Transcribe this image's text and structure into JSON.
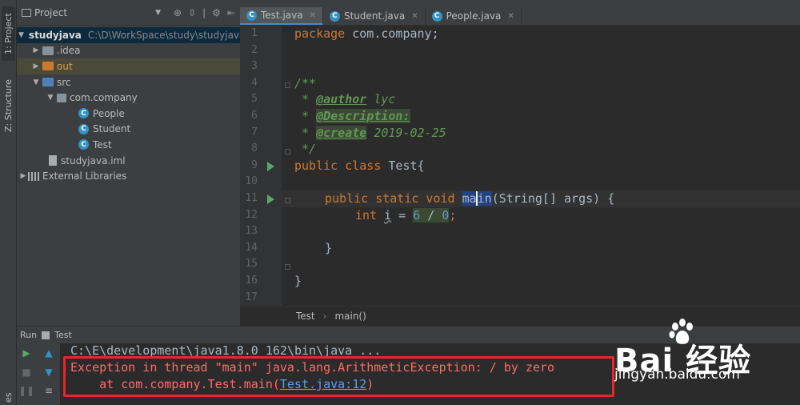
{
  "left_strip": {
    "project_tab": "1: Project",
    "structure_tab": "Z: Structure",
    "bottom_text": "es"
  },
  "project": {
    "title": "Project",
    "root": {
      "name": "studyjava",
      "path": "C:\\D\\WorkSpace\\study\\studyjava"
    },
    "items": [
      {
        "label": ".idea"
      },
      {
        "label": "out"
      },
      {
        "label": "src"
      },
      {
        "label": "com.company"
      },
      {
        "label": "People"
      },
      {
        "label": "Student"
      },
      {
        "label": "Test"
      },
      {
        "label": "studyjava.iml"
      },
      {
        "label": "External Libraries"
      }
    ]
  },
  "tabs": [
    {
      "label": "Test.java"
    },
    {
      "label": "Student.java"
    },
    {
      "label": "People.java"
    }
  ],
  "editor": {
    "line_numbers": [
      "1",
      "2",
      "3",
      "4",
      "5",
      "6",
      "7",
      "8",
      "9",
      "10",
      "11",
      "12",
      "13",
      "14",
      "15",
      "16",
      "17"
    ],
    "lines": {
      "l1_kw": "package",
      "l1_rest": " com.company;",
      "l4": "/**",
      "l5_star": " * ",
      "l5_tag": "@author",
      "l5_val": " lyc",
      "l6_star": " * ",
      "l6_tag": "@Description:",
      "l7_star": " * ",
      "l7_tag": "@create",
      "l7_val": " 2019-02-25",
      "l8": " */",
      "l9_kw": "public class",
      "l9_rest": " Test{",
      "l11_kw": "public static void",
      "l11_ma": "ma",
      "l11_in": "in",
      "l11_rest": "(String[] args) {",
      "l12_kw": "int",
      "l12_var": "i",
      "l12_eq": " = ",
      "l12_n1": "6",
      "l12_op": " / ",
      "l12_n2": "0",
      "l12_semi": ";",
      "l14": "}",
      "l16": "}"
    }
  },
  "breadcrumb": {
    "class": "Test",
    "method": "main()"
  },
  "run": {
    "label": "Run",
    "config": "Test",
    "command": "C:\\E\\development\\java1.8.0_162\\bin\\java ...",
    "exception": "Exception in thread \"main\" java.lang.ArithmeticException: / by zero",
    "at_prefix": "    at com.company.Test.main(",
    "at_link": "Test.java:12",
    "at_suffix": ")"
  },
  "watermark": {
    "logo": "Bai  经验",
    "url": "jingyan.baidu.com"
  }
}
